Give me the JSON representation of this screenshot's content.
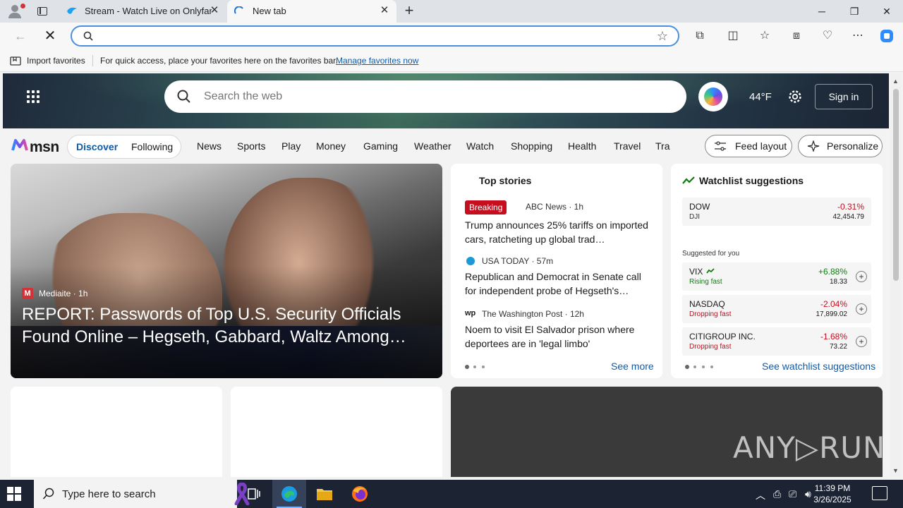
{
  "browser": {
    "tabs": [
      {
        "title": "Stream - Watch Live on Onlyfans"
      },
      {
        "title": "New tab"
      }
    ],
    "window_controls": {
      "minimize": "─",
      "restore": "❐",
      "close": "✕"
    },
    "address": {
      "value": "",
      "placeholder": ""
    },
    "favorites_bar": {
      "import_label": "Import favorites",
      "message": "For quick access, place your favorites here on the favorites bar.",
      "link": "Manage favorites now"
    }
  },
  "msn": {
    "search_placeholder": "Search the web",
    "weather_temp": "44°F",
    "sign_in": "Sign in",
    "logo_text": "msn",
    "feed_tabs": {
      "discover": "Discover",
      "following": "Following"
    },
    "nav": [
      "News",
      "Sports",
      "Play",
      "Money",
      "Gaming",
      "Weather",
      "Watch",
      "Shopping",
      "Health",
      "Travel",
      "Tra"
    ],
    "feed_layout": "Feed layout",
    "personalize": "Personalize",
    "hero_story": {
      "source": "Mediaite",
      "time": "1h",
      "source_line": "Mediaite · 1h",
      "headline": "REPORT: Passwords of Top U.S. Security Officials Found Online – Hegseth, Gabbard, Waltz Among…"
    },
    "top_stories": {
      "title": "Top stories",
      "breaking": "Breaking",
      "items": [
        {
          "source": "ABC News · 1h",
          "headline": "Trump announces 25% tariffs on imported cars, ratcheting up global trad…"
        },
        {
          "source": "USA TODAY · 57m",
          "headline": "Republican and Democrat in Senate call for independent probe of Hegseth's…"
        },
        {
          "source": "The Washington Post · 12h",
          "headline": "Noem to visit El Salvador prison where deportees are in 'legal limbo'"
        }
      ],
      "see_more": "See more"
    },
    "watchlist": {
      "title": "Watchlist suggestions",
      "suggested_label": "Suggested for you",
      "items": [
        {
          "symbol": "DOW",
          "sub": "DJI",
          "change": "-0.31%",
          "value": "42,454.79",
          "dir": "down"
        },
        {
          "symbol": "VIX",
          "sub": "Rising fast",
          "change": "+6.88%",
          "value": "18.33",
          "dir": "up"
        },
        {
          "symbol": "NASDAQ",
          "sub": "Dropping fast",
          "change": "-2.04%",
          "value": "17,899.02",
          "dir": "down"
        },
        {
          "symbol": "CITIGROUP INC.",
          "sub": "Dropping fast",
          "change": "-1.68%",
          "value": "73.22",
          "dir": "down"
        }
      ],
      "see_link": "See watchlist suggestions"
    },
    "watermark": "ANY▷RUN"
  },
  "taskbar": {
    "search_placeholder": "Type here to search",
    "time": "11:39 PM",
    "date": "3/26/2025"
  },
  "colors": {
    "accent": "#0f5ba8",
    "breaking": "#c50f1f",
    "up": "#107c10",
    "down": "#c50f1f"
  }
}
